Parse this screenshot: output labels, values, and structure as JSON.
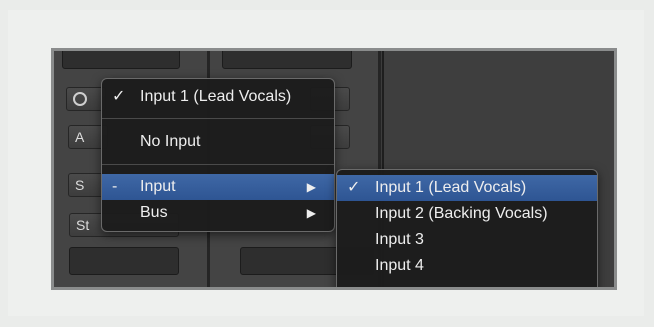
{
  "mixer": {
    "buttons": {
      "a_label": "A",
      "s_label": "S",
      "st_label": "St"
    }
  },
  "input_menu": {
    "current": {
      "check": "✓",
      "label": "Input 1  (Lead Vocals)"
    },
    "no_input": "No Input",
    "input": {
      "prefix": "-",
      "label": "Input",
      "arrow": "▶"
    },
    "bus": {
      "label": "Bus",
      "arrow": "▶"
    }
  },
  "submenu": {
    "items": [
      {
        "check": "✓",
        "label": "Input 1  (Lead Vocals)"
      },
      {
        "check": "",
        "label": "Input 2  (Backing Vocals)"
      },
      {
        "check": "",
        "label": "Input 3"
      },
      {
        "check": "",
        "label": "Input 4"
      }
    ]
  },
  "colors": {
    "highlight": "#3a62a2",
    "menu_bg": "#1c1c1c",
    "app_bg": "#3c3c3c"
  }
}
